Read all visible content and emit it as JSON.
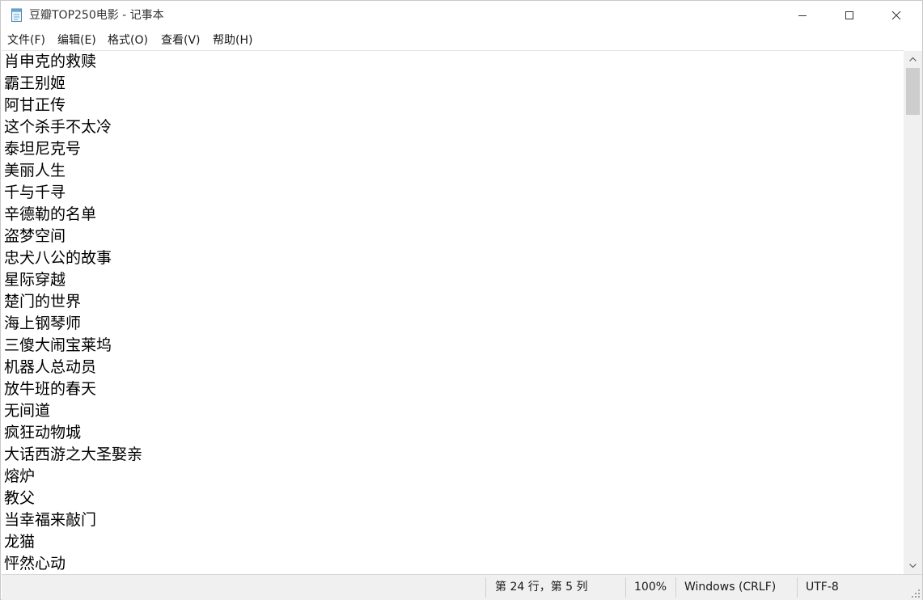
{
  "window": {
    "title": "豆瓣TOP250电影 - 记事本",
    "icon": "notepad-icon"
  },
  "menu": [
    {
      "label": "文件(F)"
    },
    {
      "label": "编辑(E)"
    },
    {
      "label": "格式(O)"
    },
    {
      "label": "查看(V)"
    },
    {
      "label": "帮助(H)"
    }
  ],
  "editor": {
    "lines": [
      "肖申克的救赎",
      "霸王别姬",
      "阿甘正传",
      "这个杀手不太冷",
      "泰坦尼克号",
      "美丽人生",
      "千与千寻",
      "辛德勒的名单",
      "盗梦空间",
      "忠犬八公的故事",
      "星际穿越",
      "楚门的世界",
      "海上钢琴师",
      "三傻大闹宝莱坞",
      "机器人总动员",
      "放牛班的春天",
      "无间道",
      "疯狂动物城",
      "大话西游之大圣娶亲",
      "熔炉",
      "教父",
      "当幸福来敲门",
      "龙猫",
      "怦然心动"
    ]
  },
  "scrollbar": {
    "position_fraction": 0.0
  },
  "status": {
    "cursor": "第 24 行，第 5 列",
    "zoom": "100%",
    "line_ending": "Windows (CRLF)",
    "encoding": "UTF-8"
  }
}
